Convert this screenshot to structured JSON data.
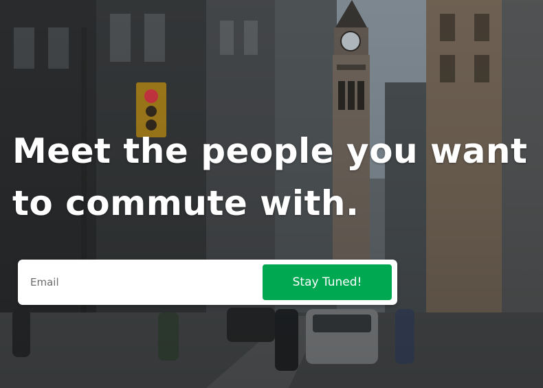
{
  "hero": {
    "headline_line1": "Meet the people you want",
    "headline_line2": "to commute with."
  },
  "signup": {
    "email_placeholder": "Email",
    "button_label": "Stay Tuned!"
  },
  "colors": {
    "button_green": "#00a852",
    "headline_text": "#ffffff",
    "form_background": "#ffffff"
  },
  "background": {
    "scene": "city-street-with-clock-tower"
  }
}
